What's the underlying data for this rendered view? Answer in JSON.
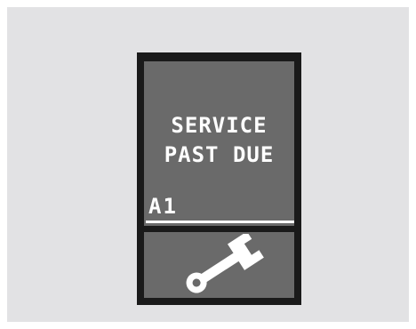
{
  "display": {
    "message_line_1": "SERVICE",
    "message_line_2": "PAST DUE",
    "service_code": "A1",
    "icon": "wrench-icon",
    "colors": {
      "background": "#e2e2e4",
      "bezel": "#1a1a1a",
      "screen": "#6a6a6a",
      "text": "#ffffff"
    }
  }
}
